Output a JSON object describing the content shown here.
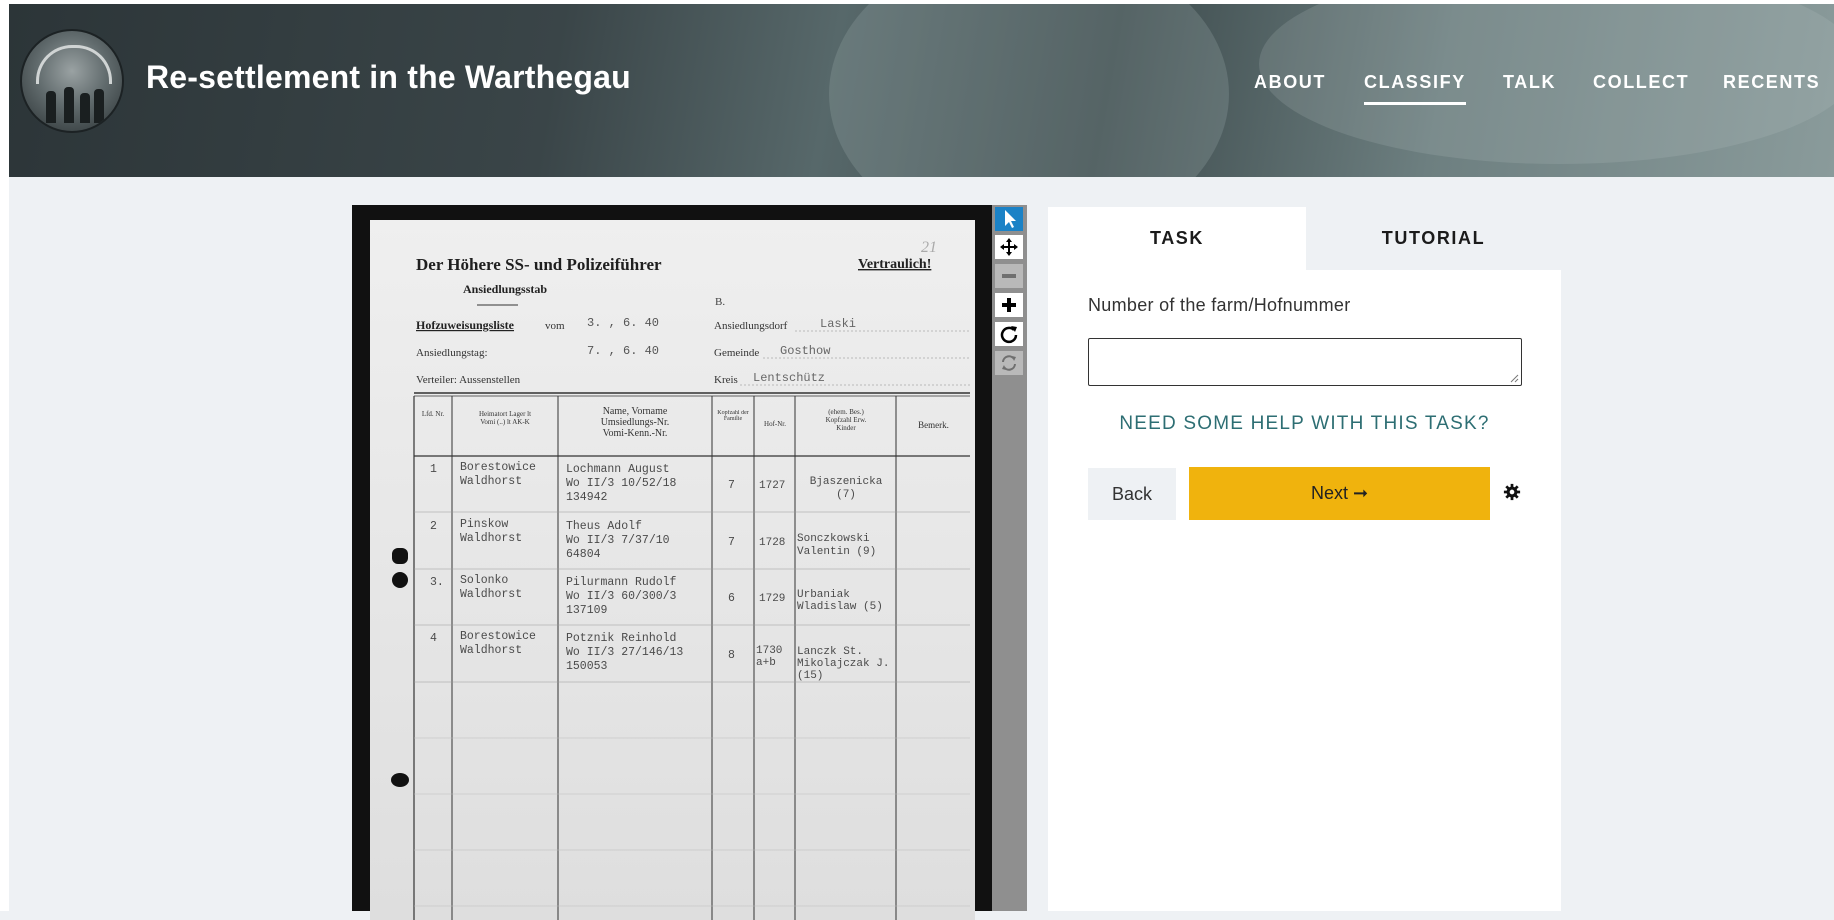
{
  "header": {
    "title": "Re-settlement in the Warthegau",
    "nav": [
      "ABOUT",
      "CLASSIFY",
      "TALK",
      "COLLECT",
      "RECENTS"
    ],
    "active_nav": "CLASSIFY"
  },
  "viewer": {
    "tools": [
      "pointer-icon",
      "move-icon",
      "zoom-out-icon",
      "zoom-in-icon",
      "rotate-icon",
      "reset-icon"
    ],
    "document": {
      "heading_line1": "Der Höhere SS- und Polizeiführer",
      "heading_line2": "Ansiedlungsstab",
      "confidential": "Vertraulich!",
      "page_number": "21",
      "b_mark": "B.",
      "list_label": "Hofzuweisungsliste",
      "vom_word": "vom",
      "vom_date": "3. , 6. 40",
      "settle_day_label": "Ansiedlungstag:",
      "settle_day_date": "7. , 6. 40",
      "distrib_label": "Verteiler: Aussenstellen",
      "village_label": "Ansiedlungsdorf",
      "village_value": "Laski",
      "commune_label": "Gemeinde",
      "commune_value": "Gosthow",
      "district_label": "Kreis",
      "district_value": "Lentschütz",
      "columns": [
        "Lfd. Nr.",
        "Heimatort Lager lt Vomi (..) lt AK-K",
        "Name, Vorname Umsiedlungs-Nr. Vomi-Kenn.-Nr.",
        "Kopfzahl der Familie",
        "Hof-Nr.",
        "(ehem. Bes.) Kopfzahl Erw. Kinder",
        "Bemerk."
      ],
      "rows": [
        {
          "nr": "1",
          "heimat": "Borestowice Waldhorst",
          "name": "Lochmann August",
          "nr2": "Wo II/3 10/52/18",
          "nr3": "134942",
          "kopf": "7",
          "hof": "1727",
          "bes": "Bjaszenicka (7)"
        },
        {
          "nr": "2",
          "heimat": "Pinskow Waldhorst",
          "name": "Theus Adolf",
          "nr2": "Wo II/3 7/37/10",
          "nr3": "64804",
          "kopf": "7",
          "hof": "1728",
          "bes": "Sonczkowski Valentin (9)"
        },
        {
          "nr": "3.",
          "heimat": "Solonko Waldhorst",
          "name": "Pilurmann Rudolf",
          "nr2": "Wo II/3 60/300/3",
          "nr3": "137109",
          "kopf": "6",
          "hof": "1729",
          "bes": "Urbaniak Wladislaw (5)"
        },
        {
          "nr": "4",
          "heimat": "Borestowice Waldhorst",
          "name": "Potznik Reinhold",
          "nr2": "Wo II/3 27/146/13",
          "nr3": "150053",
          "kopf": "8",
          "hof": "1730 a+b",
          "bes": "Lanczk St. Mikolajczak J. (15)"
        }
      ]
    }
  },
  "task_panel": {
    "tabs": [
      "TASK",
      "TUTORIAL"
    ],
    "question": "Number of the farm/Hofnummer",
    "answer_value": "",
    "help_link": "NEED SOME HELP WITH THIS TASK?",
    "back_label": "Back",
    "next_label": "Next ➞"
  },
  "colors": {
    "accent": "#f0b30d",
    "help_link": "#2d6e73",
    "selected_tool": "#1b82c6"
  }
}
